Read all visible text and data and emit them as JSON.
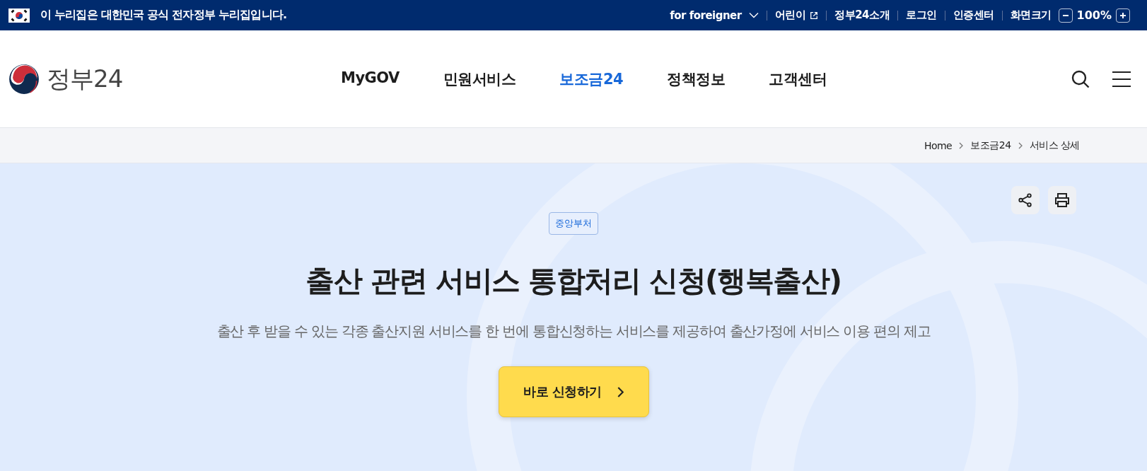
{
  "top_bar": {
    "notice": "이 누리집은 대한민국 공식 전자정부 누리집입니다.",
    "links": [
      {
        "label": "for foreigner",
        "kind": "dropdown"
      },
      {
        "label": "어린이",
        "kind": "external"
      },
      {
        "label": "정부24소개",
        "kind": "plain"
      },
      {
        "label": "로그인",
        "kind": "plain"
      },
      {
        "label": "인증센터",
        "kind": "plain"
      },
      {
        "label": "화면크기",
        "kind": "plain"
      }
    ],
    "zoom": "100%"
  },
  "header": {
    "logo": "정부24",
    "nav": [
      {
        "label": "MyGOV",
        "selected": false
      },
      {
        "label": "민원서비스",
        "selected": false
      },
      {
        "label": "보조금24",
        "selected": true
      },
      {
        "label": "정책정보",
        "selected": false
      },
      {
        "label": "고객센터",
        "selected": false
      }
    ]
  },
  "breadcrumb": [
    "Home",
    "보조금24",
    "서비스 상세"
  ],
  "service": {
    "tag": "중앙부처",
    "title": "출산 관련 서비스 통합처리 신청(행복출산)",
    "description": "출산 후 받을 수 있는 각종 출산지원 서비스를 한 번에 통합신청하는 서비스를 제공하여 출산가정에 서비스 이용 편의 제고",
    "apply_button": "바로 신청하기"
  }
}
